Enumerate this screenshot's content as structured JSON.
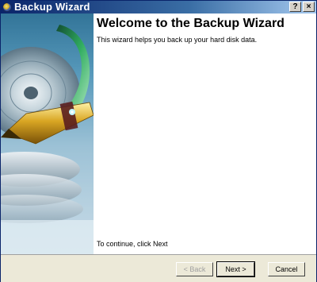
{
  "window": {
    "title": "Backup Wizard",
    "help_button": "?",
    "close_button": "×"
  },
  "page": {
    "heading": "Welcome to the Backup Wizard",
    "description": "This wizard helps you back up your hard disk data.",
    "continue_hint": "To continue, click Next"
  },
  "buttons": {
    "back": "< Back",
    "next": "Next >",
    "cancel": "Cancel"
  },
  "colors": {
    "titlebar": "#0a246a",
    "face": "#ece9d8"
  },
  "icons": {
    "title": "backup-app-icon",
    "banner": "hard-disk-with-pen-illustration"
  }
}
